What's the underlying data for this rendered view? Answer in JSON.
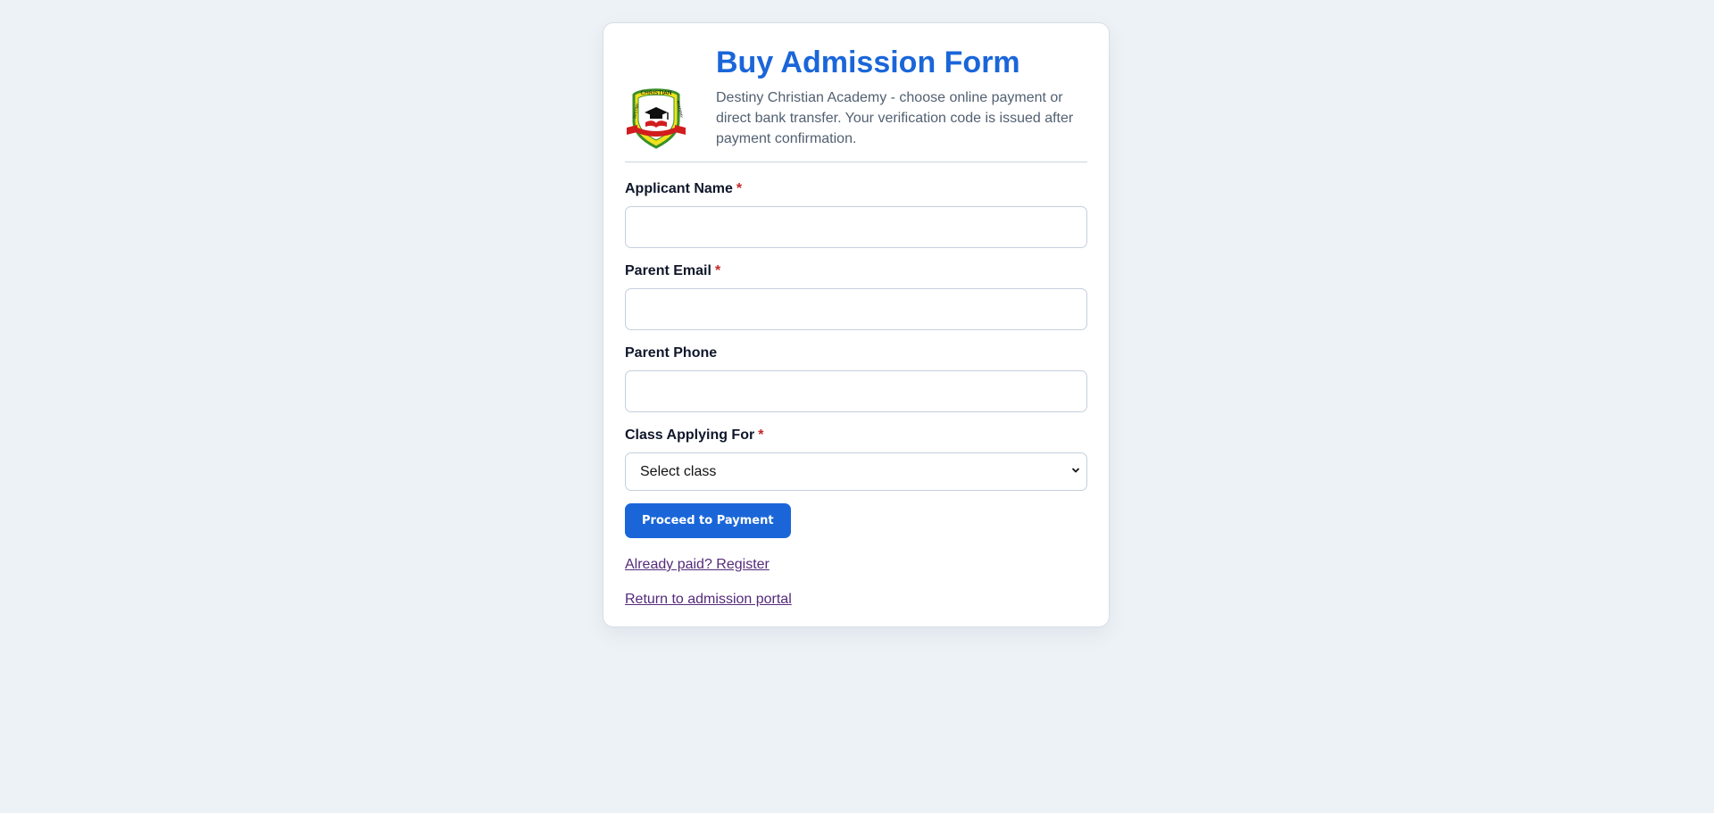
{
  "logo": {
    "name": "Destiny Christian Academy crest",
    "text_top": "CHRISTIAN",
    "text_left": "DESTINY",
    "text_right": "ACADEMY",
    "colors": {
      "shield_yellow": "#f0e21c",
      "shield_green": "#3a8f2a",
      "ribbon_red": "#d11d1d",
      "cap_black": "#0f0f0f"
    }
  },
  "header": {
    "title": "Buy Admission Form",
    "subtitle": "Destiny Christian Academy - choose online payment or direct bank transfer. Your verification code is issued after payment confirmation."
  },
  "form": {
    "fields": [
      {
        "label": "Applicant Name",
        "required_mark": "*",
        "value": "",
        "placeholder": ""
      },
      {
        "label": "Parent Email",
        "required_mark": "*",
        "value": "",
        "placeholder": ""
      },
      {
        "label": "Parent Phone",
        "value": "",
        "placeholder": ""
      }
    ],
    "class_select": {
      "label": "Class Applying For",
      "required_mark": "*",
      "selected": "Select class"
    },
    "submit_label": "Proceed to Payment"
  },
  "links": {
    "already_paid": "Already paid? Register",
    "return_portal": "Return to admission portal"
  },
  "colors": {
    "accent": "#1a66d9",
    "background": "#edf2f7",
    "link_visited": "#552a7a",
    "required": "#c52727"
  }
}
